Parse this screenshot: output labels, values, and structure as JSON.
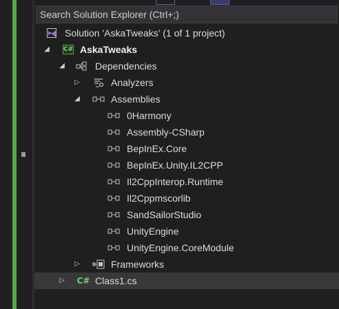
{
  "search": {
    "placeholder": "Search Solution Explorer (Ctrl+;)"
  },
  "tree": {
    "solution": "Solution 'AskaTweaks' (1 of 1 project)",
    "project": "AskaTweaks",
    "dependencies": "Dependencies",
    "analyzers": "Analyzers",
    "assemblies": "Assemblies",
    "assembly_items": [
      "0Harmony",
      "Assembly-CSharp",
      "BepInEx.Core",
      "BepInEx.Unity.IL2CPP",
      "Il2CppInterop.Runtime",
      "Il2Cppmscorlib",
      "SandSailorStudio",
      "UnityEngine",
      "UnityEngine.CoreModule"
    ],
    "frameworks": "Frameworks",
    "class_file": "Class1.cs",
    "csharp_badge": "C#"
  },
  "icons": {
    "expanded": "expanded-triangle-icon",
    "collapsed": "collapsed-triangle-icon",
    "solution": "solution-icon",
    "project": "csharp-project-icon",
    "dependencies": "dependencies-icon",
    "analyzers": "analyzers-icon",
    "reference": "reference-icon",
    "frameworks": "frameworks-icon",
    "csharp_file": "csharp-file-icon"
  },
  "colors": {
    "background": "#1f1f1f",
    "text": "#dcdcdc",
    "search_bg": "#333337",
    "selection": "#383838",
    "git_change_bar": "#57a64a",
    "csharp": "#6fcf6f"
  }
}
